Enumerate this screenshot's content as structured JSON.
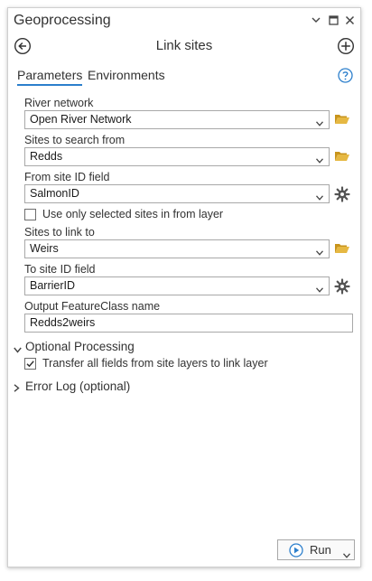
{
  "window": {
    "title": "Geoprocessing",
    "tool_title": "Link sites"
  },
  "tabs": [
    {
      "label": "Parameters",
      "active": true
    },
    {
      "label": "Environments",
      "active": false
    }
  ],
  "params": {
    "river_network": {
      "label": "River network",
      "value": "Open River Network"
    },
    "sites_from": {
      "label": "Sites to search from",
      "value": "Redds"
    },
    "from_id_field": {
      "label": "From site ID field",
      "value": "SalmonID"
    },
    "use_selected": {
      "label": "Use only selected sites in from layer",
      "checked": false
    },
    "sites_to": {
      "label": "Sites to link to",
      "value": "Weirs"
    },
    "to_id_field": {
      "label": "To site ID field",
      "value": "BarrierID"
    },
    "output_name": {
      "label": "Output FeatureClass name",
      "value": "Redds2weirs"
    }
  },
  "optional": {
    "label": "Optional Processing",
    "expanded": true,
    "transfer_fields": {
      "label": "Transfer all fields from site layers to link layer",
      "checked": true
    }
  },
  "error_log": {
    "label": "Error Log (optional)",
    "expanded": false
  },
  "run": {
    "label": "Run"
  },
  "icons": {
    "folder": "folder-open-icon",
    "field_calc": "gear-icon",
    "back": "back-arrow-icon",
    "add": "add-circle-icon",
    "help": "help-icon"
  },
  "colors": {
    "accent": "#2c7fcc",
    "folder": "#d8a92b",
    "run_play": "#2c7fcc"
  }
}
